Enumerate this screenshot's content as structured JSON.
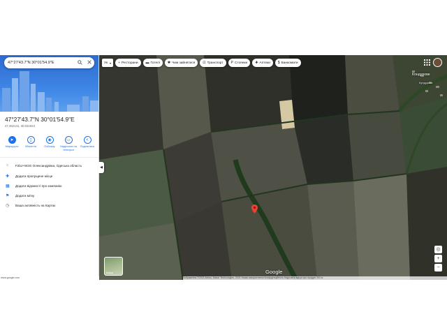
{
  "search": {
    "query": "47°27'43.7\"N 30°01'54.9\"E",
    "search_icon": "search-icon",
    "close_icon": "close-icon"
  },
  "place": {
    "title": "47°27'43.7\"N 30°01'54.9\"E",
    "subtitle": "47.462141, 30.031924"
  },
  "actions": [
    {
      "label": "Маршрути",
      "icon": "directions-icon",
      "filled": true
    },
    {
      "label": "Зберегти",
      "icon": "bookmark-icon",
      "filled": false
    },
    {
      "label": "Поблизу",
      "icon": "nearby-icon",
      "filled": false
    },
    {
      "label": "Надіслати на телефон",
      "icon": "send-to-phone-icon",
      "filled": false
    },
    {
      "label": "Поділитися",
      "icon": "share-icon",
      "filled": false
    }
  ],
  "info_rows": [
    {
      "text": "F2bJ+W2G Олександрівка, Одеська область",
      "icon": "plus-code-icon"
    },
    {
      "text": "Додати пропущене місце",
      "icon": "add-place-icon"
    },
    {
      "text": "Додати відомості про компанію",
      "icon": "add-business-icon"
    },
    {
      "text": "Додати мітку",
      "icon": "label-icon"
    },
    {
      "text": "Ваша активність на Картах",
      "icon": "history-icon"
    }
  ],
  "map": {
    "language": "Ук",
    "chips": [
      {
        "label": "Ресторани",
        "icon": "restaurant-icon"
      },
      {
        "label": "Готелі",
        "icon": "hotel-icon"
      },
      {
        "label": "Чим зайнятися",
        "icon": "attractions-icon"
      },
      {
        "label": "Транспорт",
        "icon": "transit-icon"
      },
      {
        "label": "Стоянки",
        "icon": "parking-icon"
      },
      {
        "label": "Аптеки",
        "icon": "pharmacy-icon"
      },
      {
        "label": "Банкомати",
        "icon": "atm-icon"
      }
    ],
    "place_label": "Кондурове",
    "place_label_small": "Кундурове",
    "layers_label": "Шари",
    "logo": "Google",
    "footer": "Зображення ©2023 Airbus, Maxar Technologies, 2023  Умови використання  Конфіденційність  Надіслати відгук про продукт  200 м",
    "url": "www.google.com"
  },
  "colors": {
    "accent": "#1a73e8",
    "pin": "#ea4335"
  }
}
